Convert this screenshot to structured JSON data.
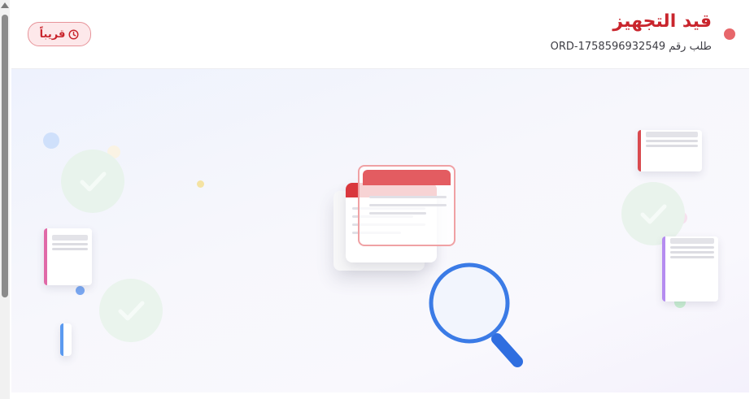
{
  "header": {
    "status_title": "قيد التجهيز",
    "order_label": "طلب رقم",
    "order_number": "ORD-1758596932549",
    "badge_label": "قريباً",
    "badge_icon": "clock-icon",
    "status_color": "#e7676b",
    "title_color": "#c9252d"
  },
  "illustration": {
    "icons": [
      "document-stack-icon",
      "magnifier-icon",
      "check-circle-icon",
      "note-card-icon"
    ],
    "colors": {
      "accent_red": "#d94a4f",
      "accent_blue": "#3b7be6",
      "accent_pink": "#e06aa8",
      "accent_purple": "#b58cf0",
      "check_green": "#e6f2ea"
    }
  }
}
